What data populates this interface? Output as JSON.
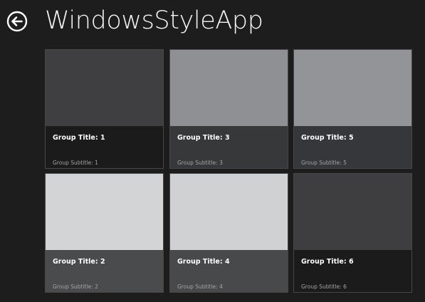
{
  "header": {
    "back_icon": "back-arrow-circle-icon",
    "title": "WindowsStyleApp"
  },
  "groups": [
    {
      "title": "Group Title: 1",
      "subtitle": "Group Subtitle: 1",
      "image_color": "#3f3f42",
      "caption_color": "#1b1b1b"
    },
    {
      "title": "Group Title: 3",
      "subtitle": "Group Subtitle: 3",
      "image_color": "#8f9094",
      "caption_color": "#37383a"
    },
    {
      "title": "Group Title: 5",
      "subtitle": "Group Subtitle: 5",
      "image_color": "#939498",
      "caption_color": "#36373a"
    },
    {
      "title": "Group Title: 2",
      "subtitle": "Group Subtitle: 2",
      "image_color": "#d3d4d6",
      "caption_color": "#4a4b4d"
    },
    {
      "title": "Group Title: 4",
      "subtitle": "Group Subtitle: 4",
      "image_color": "#d0d1d3",
      "caption_color": "#48494b"
    },
    {
      "title": "Group Title: 6",
      "subtitle": "Group Subtitle: 6",
      "image_color": "#3e3e41",
      "caption_color": "#1b1b1b"
    }
  ],
  "colors": {
    "background": "#1d1d1d",
    "title_text": "#f4f4f4",
    "subtitle_text": "#a4a4a4"
  }
}
